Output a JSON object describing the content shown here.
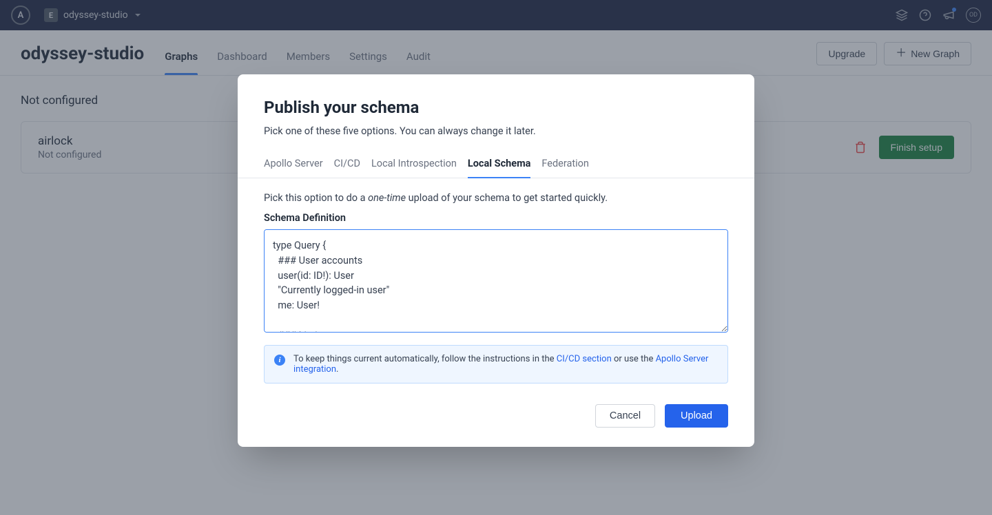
{
  "topbar": {
    "logo_letter": "A",
    "org_letter": "E",
    "org_name": "odyssey-studio",
    "avatar_initials": "OD"
  },
  "header": {
    "title": "odyssey-studio",
    "tabs": [
      {
        "label": "Graphs",
        "active": true
      },
      {
        "label": "Dashboard",
        "active": false
      },
      {
        "label": "Members",
        "active": false
      },
      {
        "label": "Settings",
        "active": false
      },
      {
        "label": "Audit",
        "active": false
      }
    ],
    "upgrade_label": "Upgrade",
    "new_graph_label": "New Graph"
  },
  "content": {
    "section_title": "Not configured",
    "graph": {
      "name": "airlock",
      "status": "Not configured",
      "finish_label": "Finish setup"
    }
  },
  "modal": {
    "title": "Publish your schema",
    "subtitle": "Pick one of these five options. You can always change it later.",
    "tabs": [
      {
        "label": "Apollo Server"
      },
      {
        "label": "CI/CD"
      },
      {
        "label": "Local Introspection"
      },
      {
        "label": "Local Schema"
      },
      {
        "label": "Federation"
      }
    ],
    "option_desc_pre": "Pick this option to do a ",
    "option_desc_em": "one-time",
    "option_desc_post": " upload of your schema to get started quickly.",
    "field_label": "Schema Definition",
    "schema_value": "type Query {\n  ### User accounts\n  user(id: ID!): User\n  \"Currently logged-in user\"\n  me: User!\n\n  ### Listings",
    "info": {
      "text_pre": "To keep things current automatically, follow the instructions in the ",
      "link1": "CI/CD section",
      "text_mid": " or use the ",
      "link2": "Apollo Server integration",
      "text_post": "."
    },
    "cancel_label": "Cancel",
    "upload_label": "Upload"
  }
}
